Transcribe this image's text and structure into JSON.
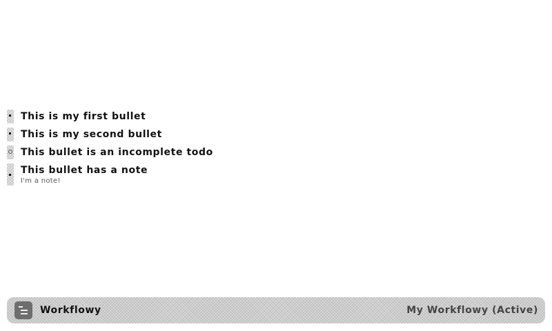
{
  "bullets": [
    {
      "text": "This is my first bullet",
      "kind": "bullet"
    },
    {
      "text": "This is my second bullet",
      "kind": "bullet"
    },
    {
      "text": "This bullet is an incomplete todo",
      "kind": "todo",
      "completed": false
    },
    {
      "text": "This bullet has a note",
      "kind": "bullet",
      "note": "I'm a note!"
    }
  ],
  "status_bar": {
    "app_icon": "workflowy-list-icon",
    "app_name": "Workflowy",
    "workspace_label": "My Workflowy (Active)"
  }
}
